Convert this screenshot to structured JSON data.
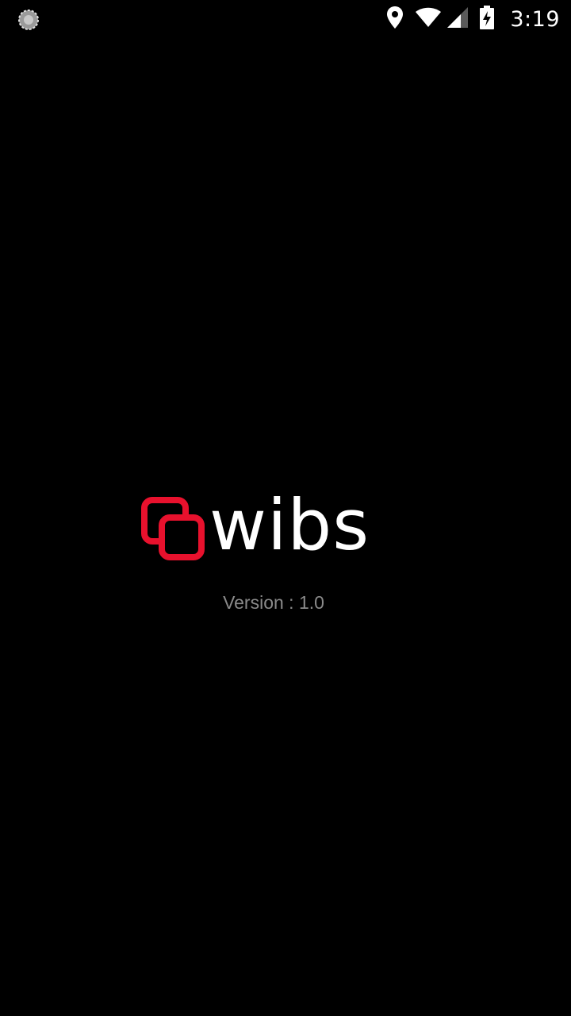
{
  "status_bar": {
    "time": "3:19",
    "icons": [
      "sync-icon",
      "location-icon",
      "wifi-icon",
      "signal-icon",
      "battery-charging-icon"
    ]
  },
  "splash": {
    "brand_name": "wibs",
    "version_text": "Version : 1.0"
  },
  "colors": {
    "background": "#000000",
    "brand_red": "#E8112D",
    "version_gray": "#8A8A8A",
    "wordmark": "#FFFFFF"
  }
}
